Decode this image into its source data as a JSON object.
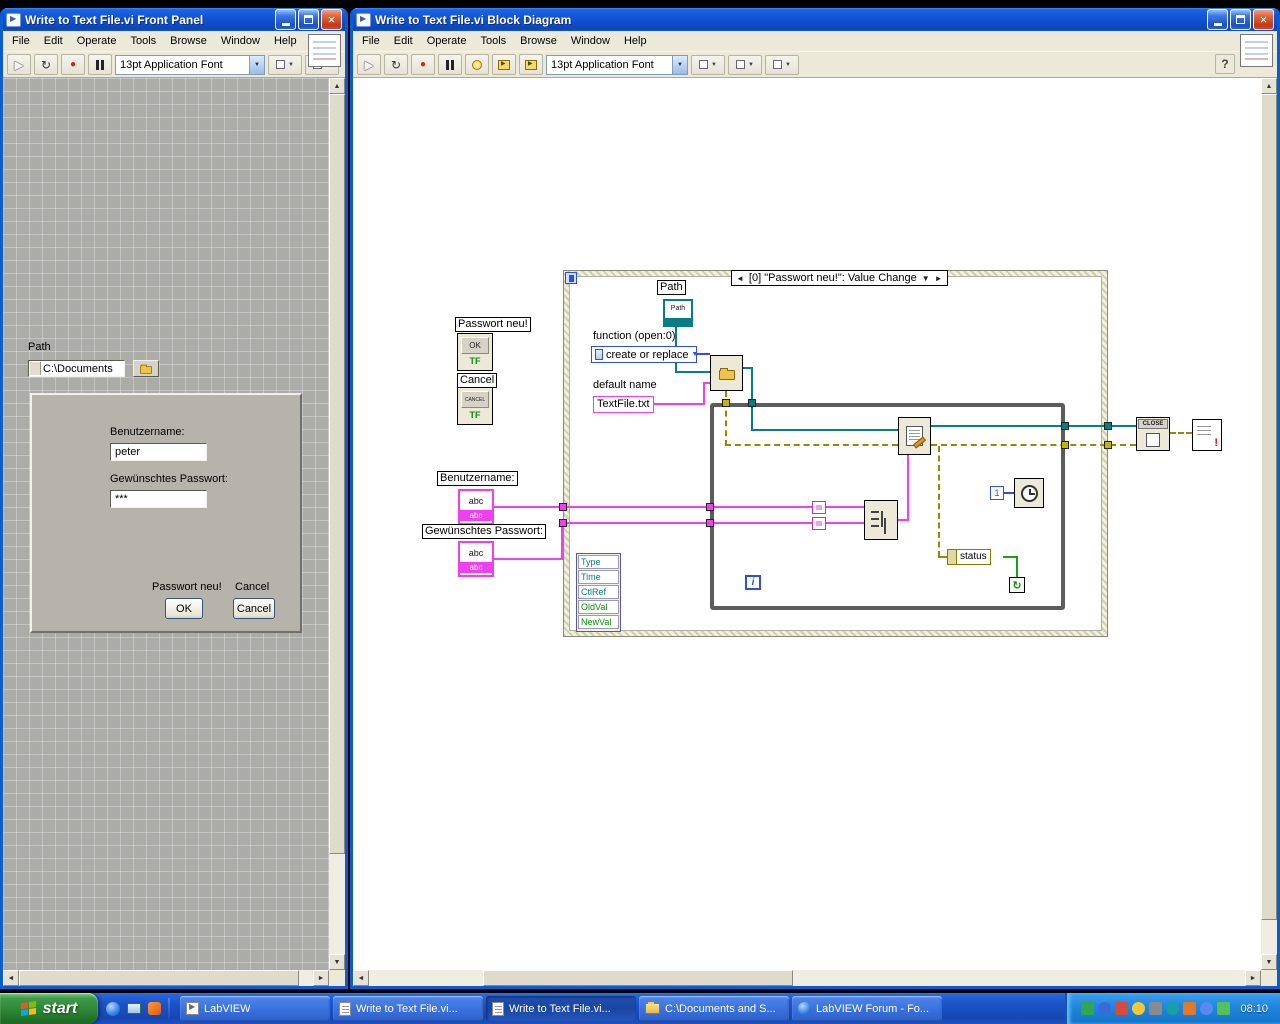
{
  "icons": {
    "run": "▶",
    "run_continuous": "↻",
    "abort": "●",
    "dropdown": "▼",
    "up_arrow": "▲",
    "down_arrow": "▼",
    "left_arrow": "◄",
    "right_arrow": "►",
    "close": "×",
    "help": "?",
    "condition_arrow": "↻",
    "exclaim": "!"
  },
  "front_panel": {
    "title": "Write to Text File.vi Front Panel",
    "menu": [
      "File",
      "Edit",
      "Operate",
      "Tools",
      "Browse",
      "Window",
      "Help"
    ],
    "font_selector": "13pt Application Font",
    "path": {
      "label": "Path",
      "value": "C:\\Documents"
    },
    "dialog": {
      "username_label": "Benutzername:",
      "username_value": "peter",
      "password_label": "Gewünschtes Passwort:",
      "password_value": "***",
      "ok_caption": "Passwort neu!",
      "cancel_caption": "Cancel",
      "ok_button": "OK",
      "cancel_button": "Cancel"
    }
  },
  "block_diagram": {
    "title": "Write to Text File.vi Block Diagram",
    "menu": [
      "File",
      "Edit",
      "Operate",
      "Tools",
      "Browse",
      "Window",
      "Help"
    ],
    "font_selector": "13pt Application Font",
    "diagram": {
      "ok_label": "Passwort neu!",
      "ok_button_text": "OK",
      "cancel_label": "Cancel",
      "cancel_button_text": "CANCEL",
      "boolean_type": "TF",
      "string_type": "abc",
      "username_label": "Benutzername:",
      "password_label": "Gewünschtes Passwort:",
      "event_header": "[0] \"Passwort neu!\": Value Change",
      "path_label": "Path",
      "path_terminal": "Path",
      "function_label": "function (open:0)",
      "function_value": "create or replace",
      "default_name_label": "default name",
      "default_name_value": "TextFile.txt",
      "event_data_fields": [
        "Type",
        "Time",
        "CtlRef",
        "OldVal",
        "NewVal"
      ],
      "close_node_text": "CLOSE",
      "status_label": "status",
      "wait_constant": "1",
      "iteration_label": "i"
    }
  },
  "taskbar": {
    "start_label": "start",
    "tasks": [
      {
        "label": "LabVIEW"
      },
      {
        "label": "Write to Text File.vi..."
      },
      {
        "label": "Write to Text File.vi..."
      },
      {
        "label": "C:\\Documents and S..."
      },
      {
        "label": "LabVIEW Forum - Fo..."
      }
    ],
    "clock": "08:10"
  }
}
